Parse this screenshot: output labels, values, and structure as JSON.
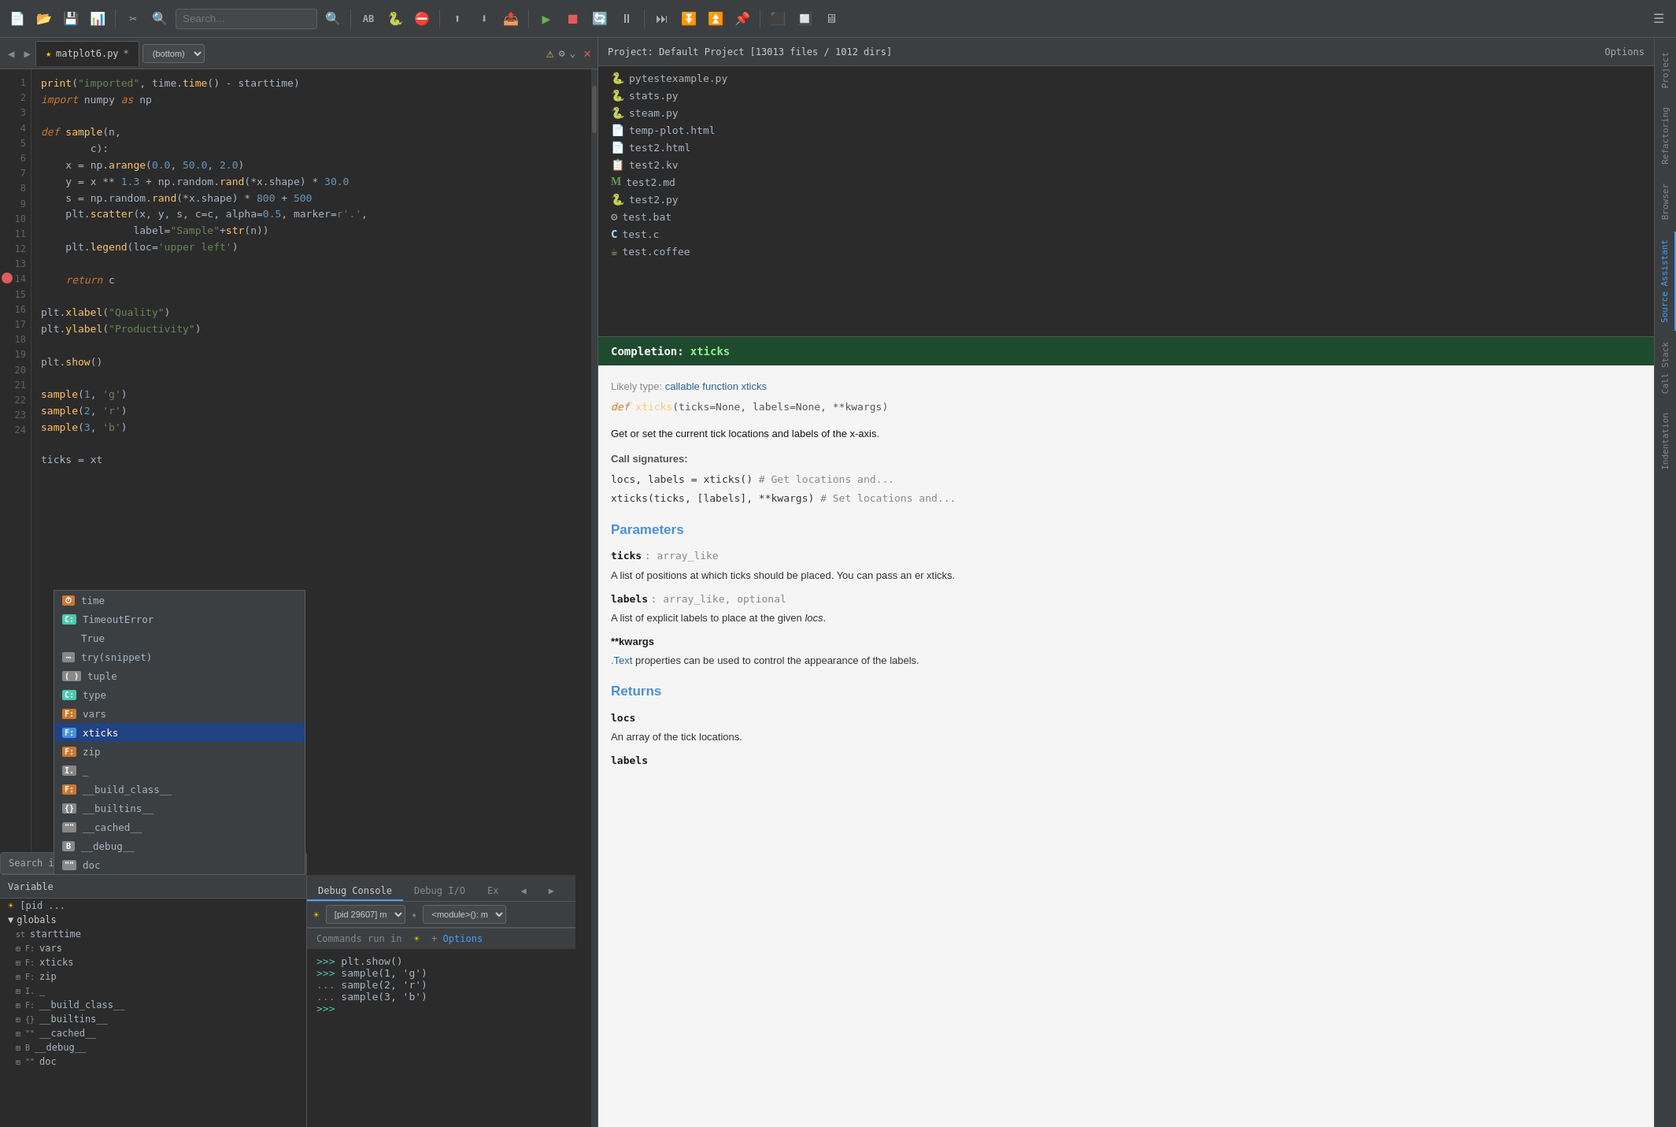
{
  "toolbar": {
    "icons": [
      "📁",
      "📂",
      "💾",
      "📊",
      "✂",
      "🔍",
      "AB",
      "🐍",
      "⛔",
      "⬆",
      "⬇",
      "📤",
      "▶",
      "⏹",
      "🔄",
      "⏸",
      "⏭",
      "🔀",
      "📌",
      "⚙"
    ]
  },
  "tab": {
    "star": "★",
    "filename": "matplot6.py",
    "modified": "*",
    "position": "(bottom)",
    "warn": "⚠",
    "close": "✕"
  },
  "editor": {
    "code_lines": [
      {
        "num": "",
        "code": "print(\"imported\", time.time() - starttime)"
      },
      {
        "num": "",
        "code": "import numpy as np"
      },
      {
        "num": "",
        "code": ""
      },
      {
        "num": "",
        "code": "def sample(n,"
      },
      {
        "num": "",
        "code": "          c):"
      },
      {
        "num": "",
        "code": "    x = np.arange(0.0, 50.0, 2.0)"
      },
      {
        "num": "",
        "code": "    y = x ** 1.3 + np.random.rand(*x.shape) * 30.0"
      },
      {
        "num": "",
        "code": "    s = np.random.rand(*x.shape) * 800 + 500"
      },
      {
        "num": "",
        "code": "    plt.scatter(x, y, s, c=c, alpha=0.5, marker=r'.', "
      },
      {
        "num": "",
        "code": "               label=\"Sample\"+str(n))"
      },
      {
        "num": "",
        "code": "    plt.legend(loc='upper left')"
      },
      {
        "num": "",
        "code": ""
      },
      {
        "num": "",
        "code": "    return c"
      },
      {
        "num": "",
        "code": ""
      },
      {
        "num": "",
        "code": "plt.xlabel(\"Quality\")"
      },
      {
        "num": "",
        "code": "plt.ylabel(\"Productivity\")"
      },
      {
        "num": "",
        "code": ""
      },
      {
        "num": "",
        "code": "plt.show()"
      },
      {
        "num": "",
        "code": ""
      },
      {
        "num": "",
        "code": "sample(1, 'g')"
      },
      {
        "num": "",
        "code": "sample(2, 'r')"
      },
      {
        "num": "",
        "code": "sample(3, 'b')"
      },
      {
        "num": "",
        "code": ""
      },
      {
        "num": "",
        "code": "ticks = xt"
      }
    ]
  },
  "project": {
    "title": "Project: Default Project [13013 files / 1012 dirs]",
    "options_label": "Options",
    "files": [
      {
        "icon": "🐍",
        "type": "py",
        "name": "pytestexample.py"
      },
      {
        "icon": "🐍",
        "type": "py",
        "name": "stats.py"
      },
      {
        "icon": "🐍",
        "type": "py",
        "name": "steam.py"
      },
      {
        "icon": "📄",
        "type": "html",
        "name": "temp-plot.html"
      },
      {
        "icon": "📄",
        "type": "html",
        "name": "test2.html"
      },
      {
        "icon": "📄",
        "type": "kv",
        "name": "test2.kv"
      },
      {
        "icon": "M",
        "type": "md",
        "name": "test2.md"
      },
      {
        "icon": "🐍",
        "type": "py",
        "name": "test2.py"
      },
      {
        "icon": "⚙",
        "type": "bat",
        "name": "test.bat"
      },
      {
        "icon": "C",
        "type": "c",
        "name": "test.c"
      },
      {
        "icon": "☕",
        "type": "coffee",
        "name": "test.coffee"
      }
    ]
  },
  "side_tabs": {
    "right": [
      "Project",
      "Refactoring",
      "Browser",
      "Source Assistant",
      "Call Stack",
      "Indentation"
    ]
  },
  "completion": {
    "label": "Completion:",
    "name": "xticks",
    "likely_type_label": "Likely type:",
    "likely_type_text": "callable function xticks",
    "def_line": "def xticks(ticks=None, labels=None, **kwargs)",
    "description": "Get or set the current tick locations and labels of the x-axis.",
    "call_signatures_label": "Call signatures:",
    "call_signatures": [
      "locs, labels = xticks()                      # Get locations and...",
      "xticks(ticks, [labels], **kwargs)  # Set locations and..."
    ],
    "parameters_title": "Parameters",
    "parameters": [
      {
        "name": "ticks",
        "type": "array_like",
        "desc": "A list of positions at which ticks should be placed. You can pass an er xticks."
      },
      {
        "name": "labels",
        "type": "array_like, optional",
        "desc": "A list of explicit labels to place at the given locs."
      }
    ],
    "kwargs_label": "**kwargs",
    "kwargs_desc": ".Text properties can be used to control the appearance of the labels.",
    "returns_title": "Returns",
    "returns_locs": "locs",
    "returns_locs_desc": "An array of the tick locations.",
    "returns_labels": "labels"
  },
  "search": {
    "label": "Search in",
    "pid_label": "[pid",
    "pid_value": "29607] m",
    "module_label": "<module>(): m"
  },
  "autocomplete": {
    "items": [
      {
        "badge": "time",
        "badge_type": "time",
        "label": "time"
      },
      {
        "badge": "C:",
        "badge_type": "c",
        "label": "TimeoutError"
      },
      {
        "badge": "",
        "badge_type": "kw",
        "label": "True"
      },
      {
        "badge": "try(snippet)",
        "badge_type": "kw",
        "label": ""
      },
      {
        "badge": "( )",
        "badge_type": "paren",
        "label": "tuple"
      },
      {
        "badge": "C:",
        "badge_type": "c",
        "label": "type"
      },
      {
        "badge": "F:",
        "badge_type": "f",
        "label": "vars"
      },
      {
        "badge": "F:",
        "badge_type": "f",
        "label": "xticks",
        "selected": true
      },
      {
        "badge": "F:",
        "badge_type": "f",
        "label": "zip"
      },
      {
        "badge": "I.",
        "badge_type": "fn",
        "label": "_"
      },
      {
        "badge": "F:",
        "badge_type": "f",
        "label": "__build_class__"
      },
      {
        "badge": "{}",
        "badge_type": "fn",
        "label": "__builtins__"
      },
      {
        "badge": "\"\"",
        "badge_type": "fn",
        "label": "__cached__"
      },
      {
        "badge": "B",
        "badge_type": "fn",
        "label": "__debug__"
      },
      {
        "badge": "\"\"",
        "badge_type": "fn",
        "label": "doc"
      }
    ]
  },
  "vars": {
    "header": "Variable",
    "sections": [
      {
        "name": "globals",
        "expanded": true
      },
      {
        "name": "starttime"
      }
    ],
    "tree_items": [
      {
        "icon": "F:",
        "name": "vars"
      },
      {
        "icon": "F:",
        "name": "xticks"
      },
      {
        "icon": "F:",
        "name": "zip"
      },
      {
        "icon": "I.",
        "name": "_"
      },
      {
        "icon": "F:",
        "name": "__build_class__"
      },
      {
        "icon": "{}",
        "name": "__builtins__"
      },
      {
        "icon": "\"\"",
        "name": "__cached__"
      },
      {
        "icon": "B",
        "name": "__debug__"
      },
      {
        "icon": "\"\"",
        "name": "doc"
      }
    ]
  },
  "debug": {
    "tabs": [
      "Debug Console",
      "Debug I/O",
      "Ex"
    ],
    "pid_label": "[pid 29607] m",
    "module_label": "<module>(): m",
    "commands_label": "Commands run in",
    "options_label": "Options",
    "lines": [
      {
        "type": "prompt",
        "text": ">>> plt.show()"
      },
      {
        "type": "prompt",
        "text": ">>> sample(1, 'g')"
      },
      {
        "type": "cont",
        "text": "... sample(2, 'r')"
      },
      {
        "type": "cont",
        "text": "... sample(3, 'b')"
      },
      {
        "type": "prompt",
        "text": ">>>"
      }
    ]
  }
}
